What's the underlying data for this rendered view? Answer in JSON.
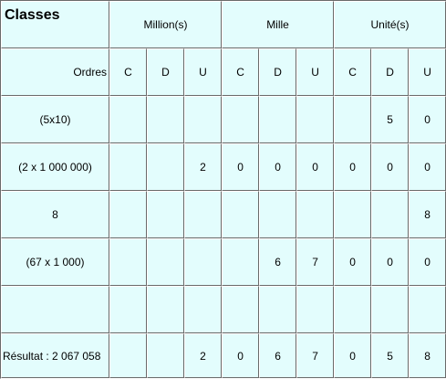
{
  "header": {
    "title": "Classes",
    "classes": [
      "Million(s)",
      "Mille",
      "Unité(s)"
    ],
    "orders_label": "Ordres",
    "orders": [
      "C",
      "D",
      "U",
      "C",
      "D",
      "U",
      "C",
      "D",
      "U"
    ]
  },
  "rows": [
    {
      "label": "(5x10)",
      "cells": [
        "",
        "",
        "",
        "",
        "",
        "",
        "",
        "5",
        "0"
      ]
    },
    {
      "label": "(2 x 1 000 000)",
      "cells": [
        "",
        "",
        "2",
        "0",
        "0",
        "0",
        "0",
        "0",
        "0"
      ]
    },
    {
      "label": "8",
      "cells": [
        "",
        "",
        "",
        "",
        "",
        "",
        "",
        "",
        "8"
      ]
    },
    {
      "label": "(67 x 1 000)",
      "cells": [
        "",
        "",
        "",
        "",
        "6",
        "7",
        "0",
        "0",
        "0"
      ]
    },
    {
      "label": "",
      "cells": [
        "",
        "",
        "",
        "",
        "",
        "",
        "",
        "",
        ""
      ]
    }
  ],
  "result": {
    "label": "Résultat : 2 067 058",
    "cells": [
      "",
      "",
      "2",
      "0",
      "6",
      "7",
      "0",
      "5",
      "8"
    ]
  }
}
